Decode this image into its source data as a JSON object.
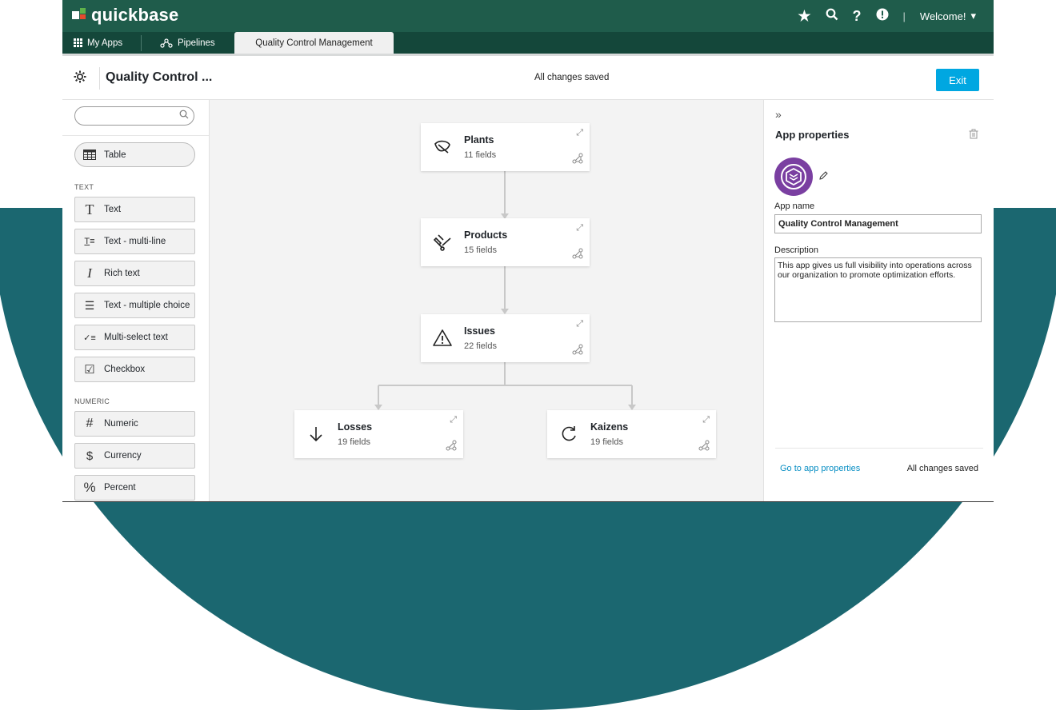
{
  "brand": {
    "name": "quickbase",
    "colors": {
      "header": "#1f5c4b",
      "tabbar": "#14473a",
      "accent": "#00a7e1",
      "background_shape": "#1b6770",
      "app_icon": "#7a3fa1"
    }
  },
  "topbar": {
    "icons": [
      "star-icon",
      "search-icon",
      "help-icon",
      "alert-icon"
    ],
    "welcome": "Welcome!"
  },
  "tabs": {
    "my_apps": "My Apps",
    "pipelines": "Pipelines",
    "active": "Quality Control Management"
  },
  "header": {
    "title": "Quality Control ...",
    "status": "All changes saved",
    "exit": "Exit"
  },
  "left": {
    "search_placeholder": "",
    "table_label": "Table",
    "text_section": "TEXT",
    "text_fields": [
      "Text",
      "Text - multi-line",
      "Rich text",
      "Text - multiple choice",
      "Multi-select text",
      "Checkbox"
    ],
    "numeric_section": "NUMERIC",
    "numeric_fields": [
      "Numeric",
      "Currency",
      "Percent"
    ]
  },
  "tables": [
    {
      "name": "Plants",
      "fields": "11 fields",
      "icon": "leaf-icon"
    },
    {
      "name": "Products",
      "fields": "15 fields",
      "icon": "tools-icon"
    },
    {
      "name": "Issues",
      "fields": "22 fields",
      "icon": "warning-icon"
    },
    {
      "name": "Losses",
      "fields": "19 fields",
      "icon": "arrow-down-icon"
    },
    {
      "name": "Kaizens",
      "fields": "19 fields",
      "icon": "refresh-icon"
    }
  ],
  "properties": {
    "title": "App properties",
    "app_name_label": "App name",
    "app_name": "Quality Control Management",
    "description_label": "Description",
    "description": "This app gives us full visibility into operations across our organization to promote optimization efforts.",
    "go_to": "Go to app properties",
    "status": "All changes saved"
  }
}
